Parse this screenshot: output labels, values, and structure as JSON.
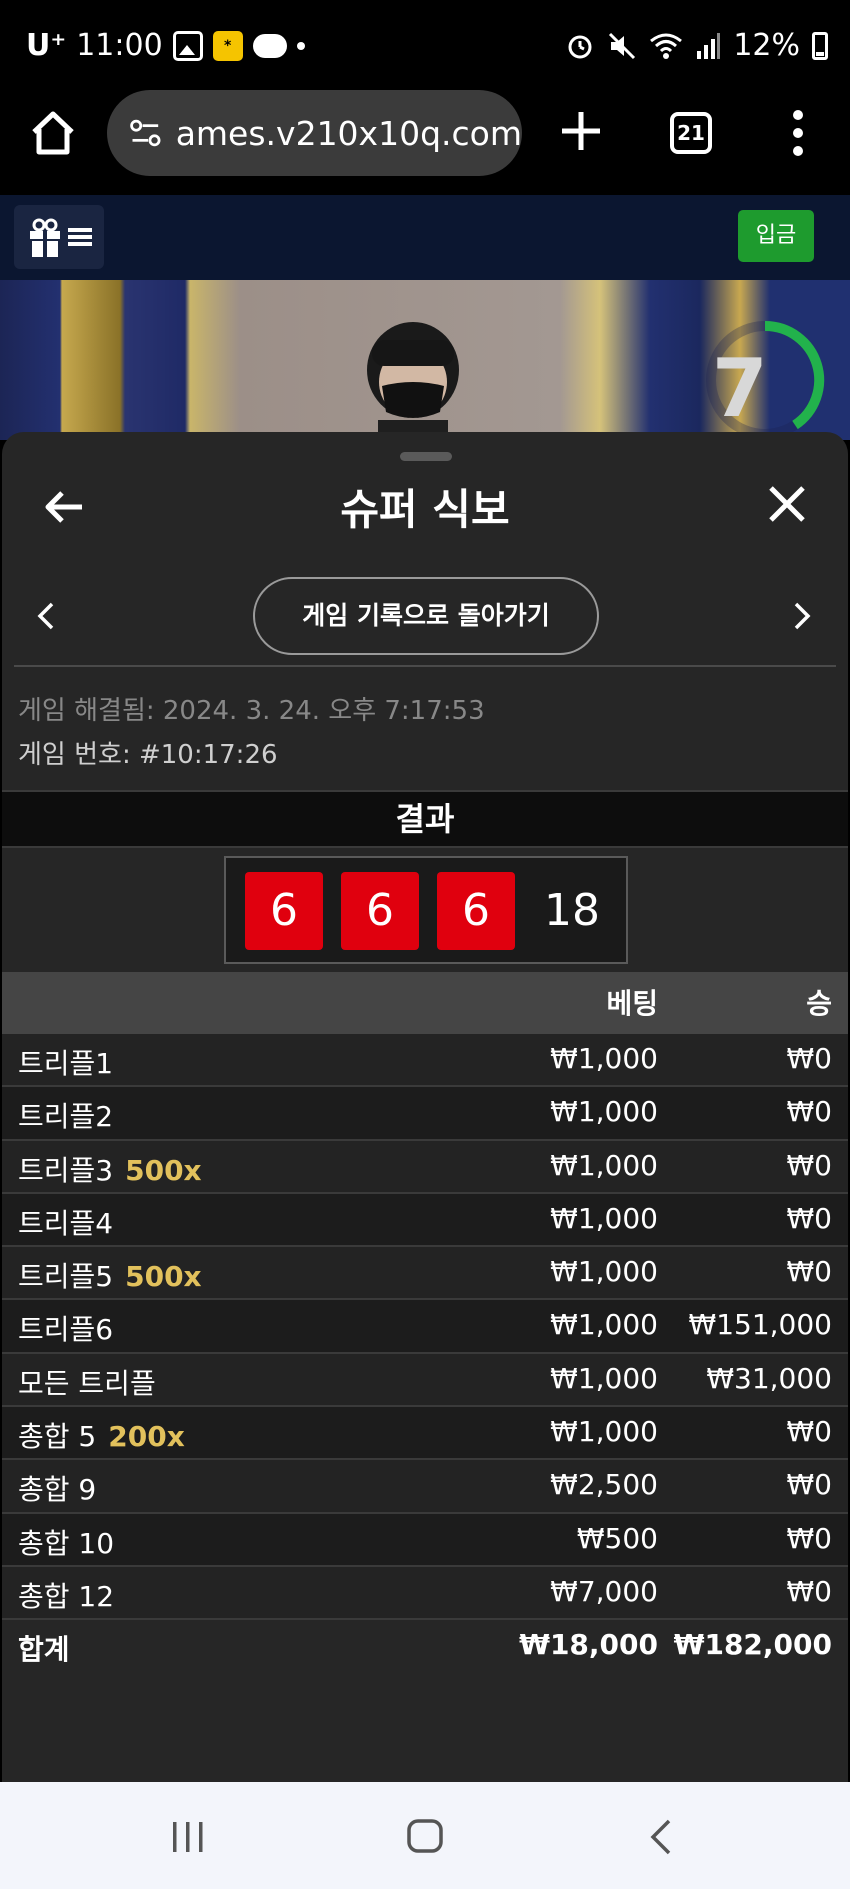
{
  "status_bar": {
    "carrier": "U⁺",
    "time": "11:00",
    "battery": "12%"
  },
  "browser": {
    "url": "ames.v210x10q.com",
    "tab_count": "21"
  },
  "site_header": {
    "deposit_label": "입금"
  },
  "video": {
    "countdown": "7"
  },
  "sheet": {
    "title": "슈퍼 식보",
    "history_button": "게임 기록으로 돌아가기",
    "resolved_label": "게임 해결됨: 2024. 3. 24. 오후 7:17:53",
    "game_number": "게임 번호: #10:17:26",
    "result_heading": "결과",
    "dice": [
      "6",
      "6",
      "6"
    ],
    "dice_sum": "18",
    "columns": {
      "bet": "베팅",
      "win": "승"
    },
    "rows": [
      {
        "label": "트리플1",
        "mult": "",
        "bet": "₩1,000",
        "win": "₩0"
      },
      {
        "label": "트리플2",
        "mult": "",
        "bet": "₩1,000",
        "win": "₩0"
      },
      {
        "label": "트리플3",
        "mult": "500x",
        "bet": "₩1,000",
        "win": "₩0"
      },
      {
        "label": "트리플4",
        "mult": "",
        "bet": "₩1,000",
        "win": "₩0"
      },
      {
        "label": "트리플5",
        "mult": "500x",
        "bet": "₩1,000",
        "win": "₩0"
      },
      {
        "label": "트리플6",
        "mult": "",
        "bet": "₩1,000",
        "win": "₩151,000"
      },
      {
        "label": "모든 트리플",
        "mult": "",
        "bet": "₩1,000",
        "win": "₩31,000"
      },
      {
        "label": "총합 5",
        "mult": "200x",
        "bet": "₩1,000",
        "win": "₩0"
      },
      {
        "label": "총합 9",
        "mult": "",
        "bet": "₩2,500",
        "win": "₩0"
      },
      {
        "label": "총합 10",
        "mult": "",
        "bet": "₩500",
        "win": "₩0"
      },
      {
        "label": "총합 12",
        "mult": "",
        "bet": "₩7,000",
        "win": "₩0"
      }
    ],
    "total": {
      "label": "합계",
      "bet": "₩18,000",
      "win": "₩182,000"
    }
  },
  "colors": {
    "die_red": "#e0000e",
    "multiplier_gold": "#e2c15c",
    "deposit_green": "#1e9b2e",
    "timer_green": "#22b24c"
  }
}
